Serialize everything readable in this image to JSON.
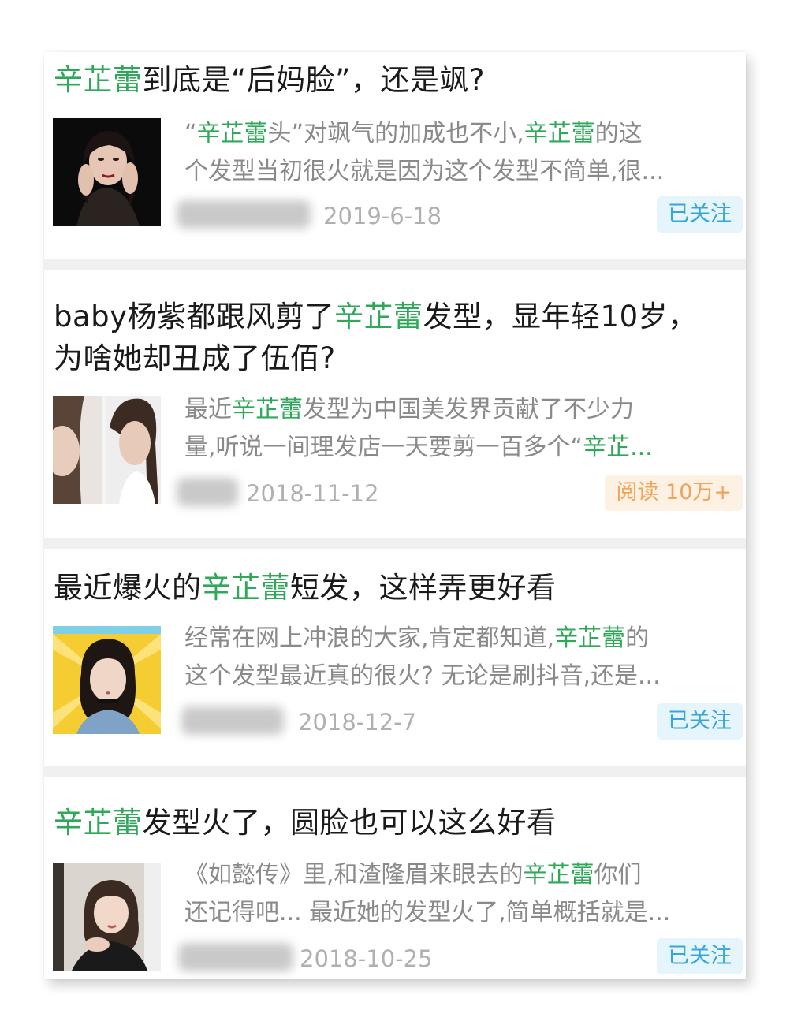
{
  "keyword": "辛芷蕾",
  "articles": [
    {
      "title_parts": [
        {
          "t": "辛芷蕾",
          "hl": true
        },
        {
          "t": "到底是“后妈脸”，还是飒?",
          "hl": false
        }
      ],
      "line1_parts": [
        {
          "t": "“",
          "hl": false
        },
        {
          "t": "辛芷蕾",
          "hl": true
        },
        {
          "t": "头”对飒气的加成也不小,",
          "hl": false
        },
        {
          "t": "辛芷蕾",
          "hl": true
        },
        {
          "t": "的这",
          "hl": false
        }
      ],
      "line2_parts": [
        {
          "t": "个发型当初很火就是因为这个发型不简单,很...",
          "hl": false
        }
      ],
      "date": "2019-6-18",
      "badge": "已关注",
      "badge_type": "follow",
      "thumb_icon": "portrait-photo"
    },
    {
      "title_parts": [
        {
          "t": "baby杨紫都跟风剪了",
          "hl": false
        },
        {
          "t": "辛芷蕾",
          "hl": true
        },
        {
          "t": "发型，显年轻10岁，",
          "hl": false
        }
      ],
      "title2_parts": [
        {
          "t": "为啥她却丑成了伍佰?",
          "hl": false
        }
      ],
      "line1_parts": [
        {
          "t": "最近",
          "hl": false
        },
        {
          "t": "辛芷蕾",
          "hl": true
        },
        {
          "t": "发型为中国美发界贡献了不少力",
          "hl": false
        }
      ],
      "line2_parts": [
        {
          "t": "量,听说一间理发店一天要剪一百多个“",
          "hl": false
        },
        {
          "t": "辛芷...",
          "hl": true
        }
      ],
      "date": "2018-11-12",
      "badge": "阅读 10万+",
      "badge_type": "read",
      "thumb_icon": "two-portraits-photo"
    },
    {
      "title_parts": [
        {
          "t": "最近爆火的",
          "hl": false
        },
        {
          "t": "辛芷蕾",
          "hl": true
        },
        {
          "t": "短发，这样弄更好看",
          "hl": false
        }
      ],
      "line1_parts": [
        {
          "t": "经常在网上冲浪的大家,肯定都知道,",
          "hl": false
        },
        {
          "t": "辛芷蕾",
          "hl": true
        },
        {
          "t": "的",
          "hl": false
        }
      ],
      "line2_parts": [
        {
          "t": "这个发型最近真的很火? 无论是刷抖音,还是...",
          "hl": false
        }
      ],
      "date": "2018-12-7",
      "badge": "已关注",
      "badge_type": "follow",
      "thumb_icon": "poster-photo"
    },
    {
      "title_parts": [
        {
          "t": "辛芷蕾",
          "hl": true
        },
        {
          "t": "发型火了，圆脸也可以这么好看",
          "hl": false
        }
      ],
      "line1_parts": [
        {
          "t": "《如懿传》里,和渣隆眉来眼去的",
          "hl": false
        },
        {
          "t": "辛芷蕾",
          "hl": true
        },
        {
          "t": "你们",
          "hl": false
        }
      ],
      "line2_parts": [
        {
          "t": "还记得吧... 最近她的发型火了,简单概括就是...",
          "hl": false
        }
      ],
      "date": "2018-10-25",
      "badge": "已关注",
      "badge_type": "follow",
      "thumb_icon": "selfie-photo"
    }
  ],
  "colors": {
    "highlight": "#2fa85a",
    "follow_badge": "#35a6db",
    "read_badge": "#f0a35a"
  }
}
